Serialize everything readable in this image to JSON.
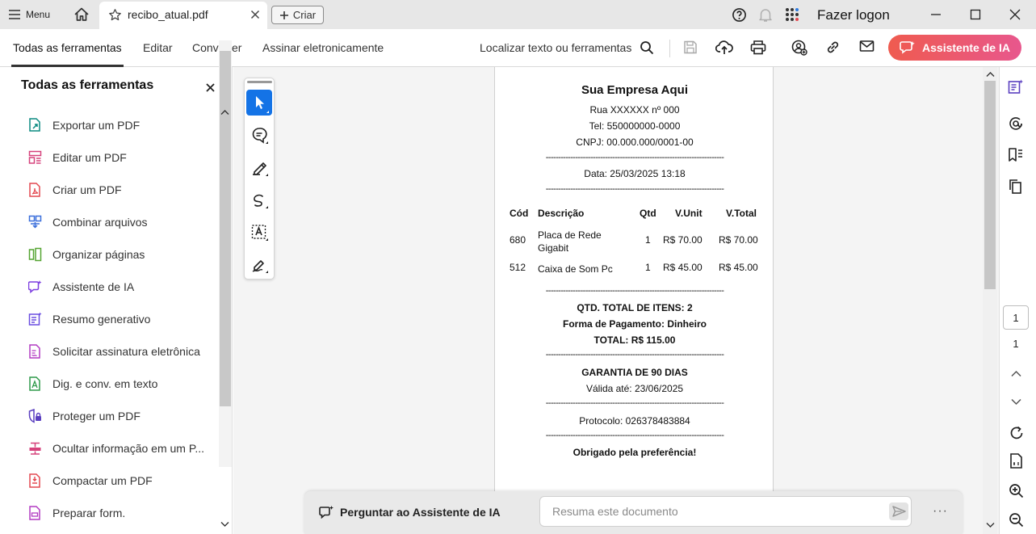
{
  "titlebar": {
    "menu_label": "Menu",
    "tab_title": "recibo_atual.pdf",
    "create_label": "Criar",
    "login_label": "Fazer logon"
  },
  "toolbar": {
    "tabs": [
      "Todas as ferramentas",
      "Editar",
      "Converter",
      "Assinar eletronicamente"
    ],
    "find_label": "Localizar texto ou ferramentas",
    "ai_button_label": "Assistente de IA",
    "ai_gradient": [
      "#ef5b4f",
      "#e8578d"
    ]
  },
  "panel": {
    "title": "Todas as ferramentas",
    "items": [
      {
        "label": "Exportar um PDF",
        "icon": "export-pdf-icon",
        "color": "#0a8a80"
      },
      {
        "label": "Editar um PDF",
        "icon": "edit-pdf-icon",
        "color": "#d6427c"
      },
      {
        "label": "Criar um PDF",
        "icon": "create-pdf-icon",
        "color": "#e34850"
      },
      {
        "label": "Combinar arquivos",
        "icon": "combine-files-icon",
        "color": "#3a6fdb"
      },
      {
        "label": "Organizar páginas",
        "icon": "organize-pages-icon",
        "color": "#54a431"
      },
      {
        "label": "Assistente de IA",
        "icon": "ai-assistant-icon",
        "color": "#7c3ee0"
      },
      {
        "label": "Resumo generativo",
        "icon": "generative-summary-icon",
        "color": "#6a4ee0"
      },
      {
        "label": "Solicitar assinatura eletrônica",
        "icon": "request-signature-icon",
        "color": "#b23bc2"
      },
      {
        "label": "Dig. e conv. em texto",
        "icon": "scan-ocr-icon",
        "color": "#2f9a4a"
      },
      {
        "label": "Proteger um PDF",
        "icon": "protect-pdf-icon",
        "color": "#5a3fc0"
      },
      {
        "label": "Ocultar informação em um P...",
        "icon": "redact-icon",
        "color": "#d6427c"
      },
      {
        "label": "Compactar um PDF",
        "icon": "compress-pdf-icon",
        "color": "#e34850"
      },
      {
        "label": "Preparar form.",
        "icon": "prepare-form-icon",
        "color": "#b23bc2"
      }
    ]
  },
  "receipt": {
    "company": "Sua Empresa Aqui",
    "address": "Rua XXXXXX nº 000",
    "phone": "Tel: 550000000-0000",
    "cnpj": "CNPJ: 00.000.000/0001-00",
    "divider": "------------------------------------------------------------------------",
    "date": "Data: 25/03/2025 13:18",
    "headers": [
      "Cód",
      "Descrição",
      "Qtd",
      "V.Unit",
      "V.Total"
    ],
    "rows": [
      {
        "code": "680",
        "desc1": "Placa de Rede",
        "desc2": "Gigabit",
        "qty": "1",
        "unit": "R$ 70.00",
        "total": "R$ 70.00"
      },
      {
        "code": "512",
        "desc1": "Caixa de Som Pc",
        "desc2": "",
        "qty": "1",
        "unit": "R$ 45.00",
        "total": "R$ 45.00"
      }
    ],
    "total_items": "QTD. TOTAL DE ITENS: 2",
    "payment": "Forma de Pagamento: Dinheiro",
    "total": "TOTAL: R$ 115.00",
    "warranty": "GARANTIA DE 90 DIAS",
    "valid_until": "Válida até: 23/06/2025",
    "protocol": "Protocolo: 026378483884",
    "thanks": "Obrigado pela preferência!"
  },
  "navigation": {
    "current_page": "1",
    "total_pages": "1"
  },
  "ai_bar": {
    "label": "Perguntar ao Assistente de IA",
    "placeholder": "Resuma este documento",
    "more": "···"
  }
}
